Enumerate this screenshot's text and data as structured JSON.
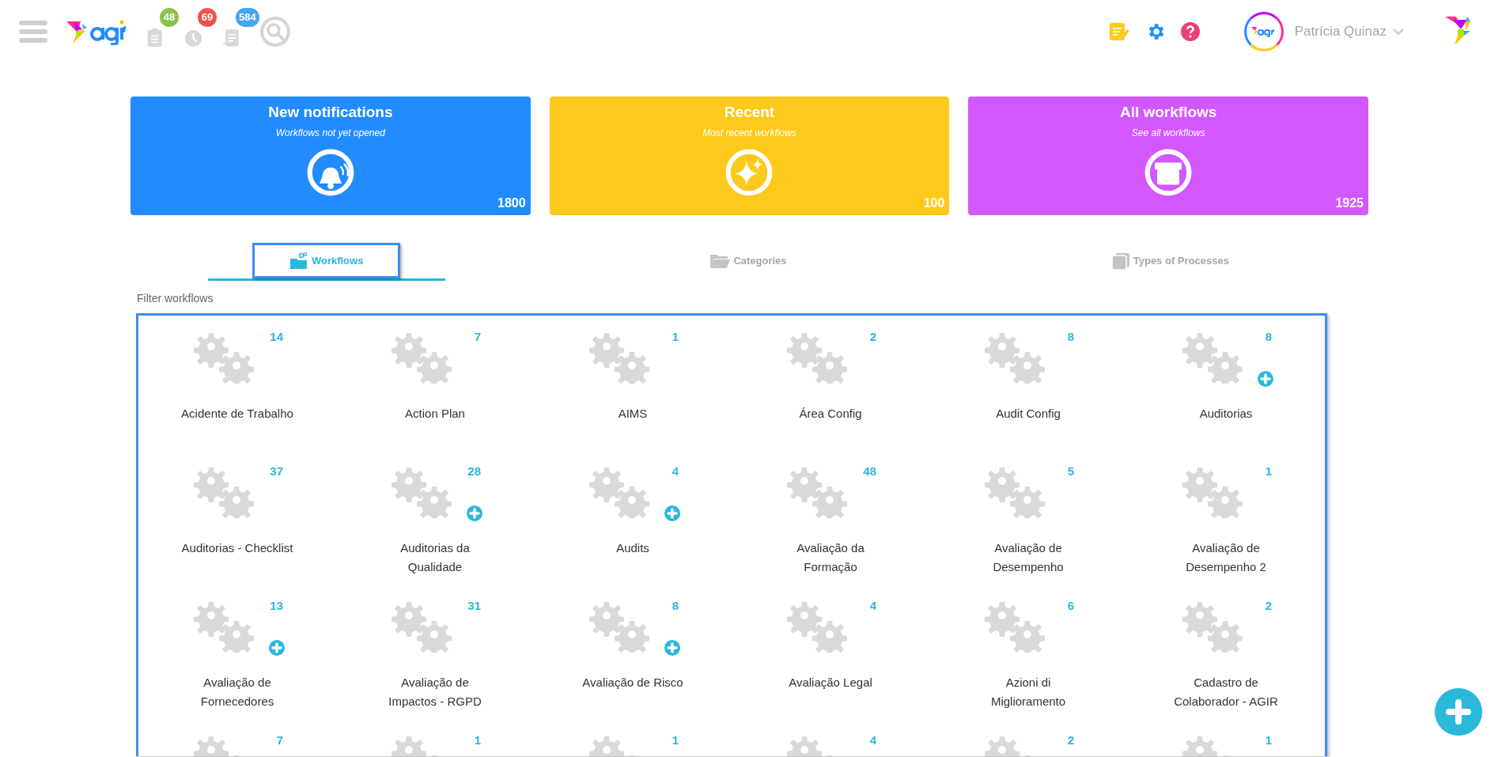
{
  "header": {
    "badges": [
      {
        "kind": "clipboard",
        "count": "48",
        "color": "#8bc34a"
      },
      {
        "kind": "clock",
        "count": "69",
        "color": "#ef5350"
      },
      {
        "kind": "document",
        "count": "584",
        "color": "#42a5f5"
      }
    ],
    "user": {
      "name": "Patrícia Quinaz"
    }
  },
  "cards": [
    {
      "kind": "bell",
      "title": "New notifications",
      "subtitle": "Workflows not yet opened",
      "count": "1800",
      "color": "#228cff"
    },
    {
      "kind": "sparkle",
      "title": "Recent",
      "subtitle": "Most recent workflows",
      "count": "100",
      "color": "#fdc91c"
    },
    {
      "kind": "box",
      "title": "All workflows",
      "subtitle": "See all workflows",
      "count": "1925",
      "color": "#d357fe"
    }
  ],
  "tabs": [
    {
      "kind": "workflows",
      "label": "Workflows",
      "selected": true
    },
    {
      "kind": "categories",
      "label": "Categories",
      "selected": false
    },
    {
      "kind": "types",
      "label": "Types of Processes",
      "selected": false
    }
  ],
  "filter_label": "Filter workflows",
  "workflows": [
    {
      "count": "14",
      "label": "Acidente de Trabalho",
      "can_add": false
    },
    {
      "count": "7",
      "label": "Action Plan",
      "can_add": false
    },
    {
      "count": "1",
      "label": "AIMS",
      "can_add": false
    },
    {
      "count": "2",
      "label": "Área Config",
      "can_add": false
    },
    {
      "count": "8",
      "label": "Audit Config",
      "can_add": false
    },
    {
      "count": "8",
      "label": "Auditorias",
      "can_add": true
    },
    {
      "count": "37",
      "label": "Auditorias - Checklist",
      "can_add": false
    },
    {
      "count": "28",
      "label": "Auditorias da Qualidade",
      "can_add": true
    },
    {
      "count": "4",
      "label": "Audits",
      "can_add": true
    },
    {
      "count": "48",
      "label": "Avaliação da Formação",
      "can_add": false
    },
    {
      "count": "5",
      "label": "Avaliação de Desempenho",
      "can_add": false
    },
    {
      "count": "1",
      "label": "Avaliação de Desempenho 2",
      "can_add": false
    },
    {
      "count": "13",
      "label": "Avaliação de Fornecedores",
      "can_add": true
    },
    {
      "count": "31",
      "label": "Avaliação de Impactos - RGPD",
      "can_add": false
    },
    {
      "count": "8",
      "label": "Avaliação de Risco",
      "can_add": true
    },
    {
      "count": "4",
      "label": "Avaliação Legal",
      "can_add": false
    },
    {
      "count": "6",
      "label": "Azioni di Miglioramento",
      "can_add": false
    },
    {
      "count": "2",
      "label": "Cadastro de Colaborador - AGIR",
      "can_add": false
    },
    {
      "count": "7",
      "can_add": false
    },
    {
      "count": "1",
      "can_add": false
    },
    {
      "count": "1",
      "can_add": false
    },
    {
      "count": "4",
      "can_add": false
    },
    {
      "count": "2",
      "can_add": false
    },
    {
      "count": "1",
      "can_add": false
    }
  ]
}
